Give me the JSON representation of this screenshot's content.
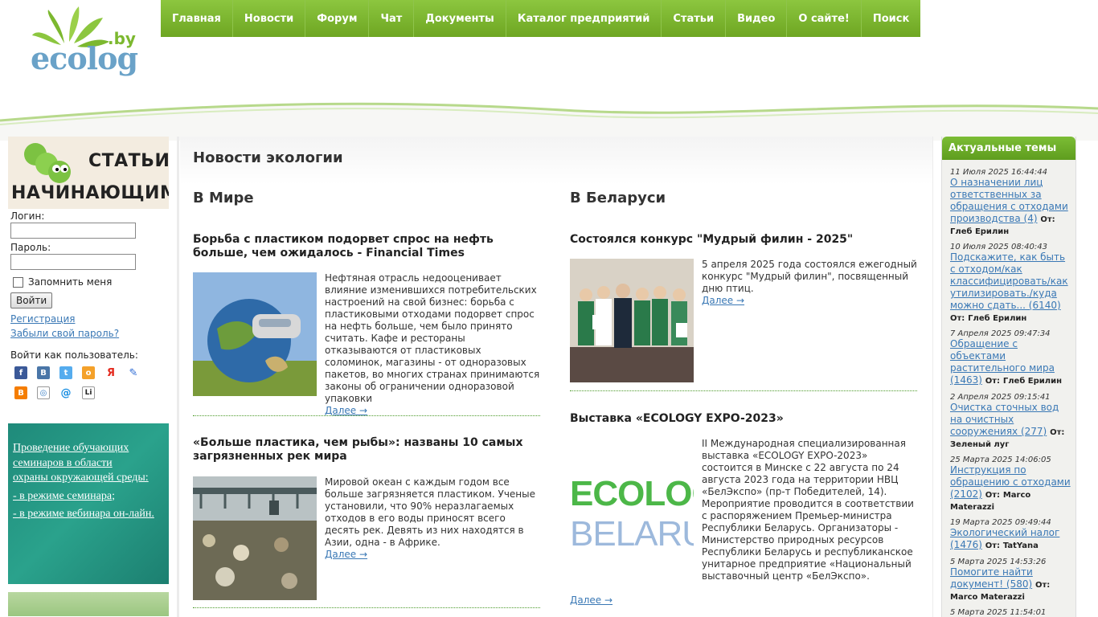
{
  "logo": {
    "domain": ".by",
    "name": "ecolog"
  },
  "nav": [
    {
      "label": "Главная"
    },
    {
      "label": "Новости"
    },
    {
      "label": "Форум"
    },
    {
      "label": "Чат"
    },
    {
      "label": "Документы"
    },
    {
      "label": "Каталог предприятий"
    },
    {
      "label": "Статьи"
    },
    {
      "label": "Видео"
    },
    {
      "label": "О сайте!"
    },
    {
      "label": "Поиск"
    }
  ],
  "left": {
    "banner_top": {
      "line1": "СТАТЬИ",
      "line2": "НАЧИНАЮЩИМ"
    },
    "login_label": "Логин:",
    "password_label": "Пароль:",
    "remember_label": "Запомнить меня",
    "login_button": "Войти",
    "register_link": "Регистрация",
    "forgot_link": "Забыли свой пароль?",
    "social_title": "Войти как пользователь:",
    "seminar_banner": {
      "line1": "Проведение обучающих",
      "line2": "семинаров в области",
      "line3": "охраны окружающей среды:",
      "line4": "- в режиме семинара;",
      "line5": "- в режиме вебинара он-лайн."
    }
  },
  "main": {
    "title": "Новости экологии",
    "world_title": "В Мире",
    "belarus_title": "В Беларуси",
    "more_label": "Далее →",
    "world": [
      {
        "title": "Борьба с пластиком подорвет спрос на нефть больше, чем ожидалось - Financial Times",
        "text": "Нефтяная отрасль недооценивает влияние изменившихся потребительских настроений на свой бизнес: борьба с пластиковыми отходами подорвет спрос на нефть больше, чем было принято считать. Кафе и рестораны отказываются от пластиковых соломинок, магазины - от одноразовых пакетов, во многих странах принимаются законы об ограничении одноразовой упаковки"
      },
      {
        "title": "«Больше пластика, чем рыбы»: названы 10 самых загрязненных рек мира",
        "text": "Мировой океан с каждым годом все больше загрязняется пластиком. Ученые установили, что 90% неразлагаемых отходов в его воды приносят всего десять рек. Девять из них находятся в Азии, одна - в Африке."
      }
    ],
    "belarus": [
      {
        "title": "Состоялся конкурс \"Мудрый филин - 2025\"",
        "text": "5 апреля 2025 года состоялся ежегодный конкурс \"Мудрый филин\", посвященный дню птиц."
      },
      {
        "title": "Выставка «ECOLOGY EXPO-2023»",
        "text": "II Международная специализированная выставка «ECOLOGY EXPO-2023» состоится в Минске с 22 августа по 24 августа 2023 года на территории НВЦ «БелЭкспо» (пр-т Победителей, 14). Мероприятие проводится в соответствии с распоряжением Премьер-министра Республики Беларусь. Организаторы - Министерство природных ресурсов Республики Беларусь и республиканское унитарное предприятие «Национальный выставочный центр «БелЭкспо».",
        "image_text1": "ECOLOG",
        "image_text2": "BELARU"
      }
    ]
  },
  "right": {
    "title": "Актуальные темы",
    "by_label": "От:",
    "topics": [
      {
        "date": "11 Июля 2025 16:44:44",
        "title": "О назначении лиц ответственных за обращения с отходами производства (4)",
        "author": "Глеб Ерилин"
      },
      {
        "date": "10 Июля 2025 08:40:43",
        "title": "Подскажите, как быть с отходом/как классифицировать/как утилизировать./куда можно сдать... (6140)",
        "author": "Глеб Ерилин"
      },
      {
        "date": "7 Апреля 2025 09:47:34",
        "title": "Обращение с объектами растительного мира (1463)",
        "author": "Глеб Ерилин"
      },
      {
        "date": "2 Апреля 2025 09:15:41",
        "title": "Очистка сточных вод на очистных сооружениях (277)",
        "author": "Зеленый луг"
      },
      {
        "date": "25 Марта 2025 14:06:05",
        "title": "Инструкция по обращению с отходами (2102)",
        "author": "Marco Materazzi"
      },
      {
        "date": "19 Марта 2025 09:49:44",
        "title": "Экологический налог (1476)",
        "author": "TatYana"
      },
      {
        "date": "5 Марта 2025 14:53:26",
        "title": "Помогите найти документ! (580)",
        "author": "Marco Materazzi"
      },
      {
        "date": "5 Марта 2025 11:54:01",
        "title": "",
        "author": ""
      }
    ]
  }
}
